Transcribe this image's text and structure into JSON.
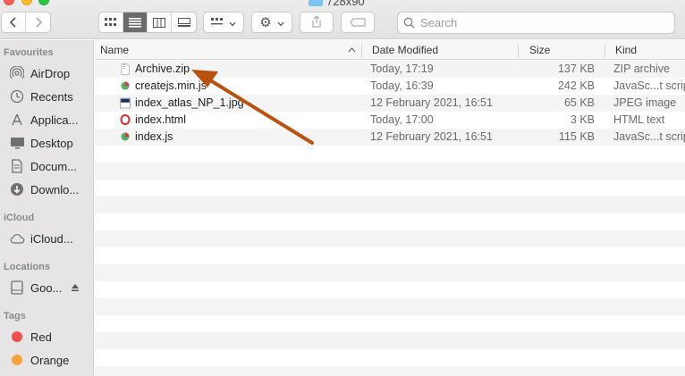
{
  "window": {
    "title": "728x90"
  },
  "toolbar": {
    "back_icon": "chevron-left-icon",
    "forward_icon": "chevron-right-icon",
    "view_modes": [
      "icon-view-icon",
      "list-view-icon",
      "column-view-icon",
      "gallery-view-icon"
    ],
    "active_view": "list",
    "group_icon": "group-by-icon",
    "action_icon": "gear-icon",
    "share_icon": "share-icon",
    "tag_icon": "tag-icon",
    "search_placeholder": "Search"
  },
  "sidebar": {
    "favourites_heading": "Favourites",
    "favourites": [
      {
        "label": "AirDrop",
        "icon": "airdrop-icon"
      },
      {
        "label": "Recents",
        "icon": "clock-icon"
      },
      {
        "label": "Applica...",
        "icon": "applications-icon"
      },
      {
        "label": "Desktop",
        "icon": "desktop-icon"
      },
      {
        "label": "Docum...",
        "icon": "document-icon"
      },
      {
        "label": "Downlo...",
        "icon": "download-icon"
      }
    ],
    "icloud_heading": "iCloud",
    "icloud": [
      {
        "label": "iCloud...",
        "icon": "cloud-icon"
      }
    ],
    "locations_heading": "Locations",
    "locations": [
      {
        "label": "Goo...",
        "icon": "drive-icon",
        "eject_icon": "eject-icon"
      }
    ],
    "tags_heading": "Tags",
    "tags": [
      {
        "label": "Red",
        "color": "#f0514c"
      },
      {
        "label": "Orange",
        "color": "#f6a43a"
      }
    ]
  },
  "columns": {
    "name": "Name",
    "date": "Date Modified",
    "size": "Size",
    "kind": "Kind"
  },
  "files": [
    {
      "name": "Archive.zip",
      "date": "Today, 17:19",
      "size": "137 KB",
      "kind": "ZIP archive",
      "icon": "zip-file-icon"
    },
    {
      "name": "createjs.min.js",
      "date": "Today, 16:39",
      "size": "242 KB",
      "kind": "JavaSc...t script",
      "icon": "js-file-icon"
    },
    {
      "name": "index_atlas_NP_1.jpg",
      "date": "12 February 2021, 16:51",
      "size": "65 KB",
      "kind": "JPEG image",
      "icon": "jpeg-file-icon"
    },
    {
      "name": "index.html",
      "date": "Today, 17:00",
      "size": "3 KB",
      "kind": "HTML text",
      "icon": "html-file-icon"
    },
    {
      "name": "index.js",
      "date": "12 February 2021, 16:51",
      "size": "115 KB",
      "kind": "JavaSc...t script",
      "icon": "js-file-icon"
    }
  ],
  "annotation": {
    "icon": "annotation-arrow",
    "color": "#b9520f"
  }
}
